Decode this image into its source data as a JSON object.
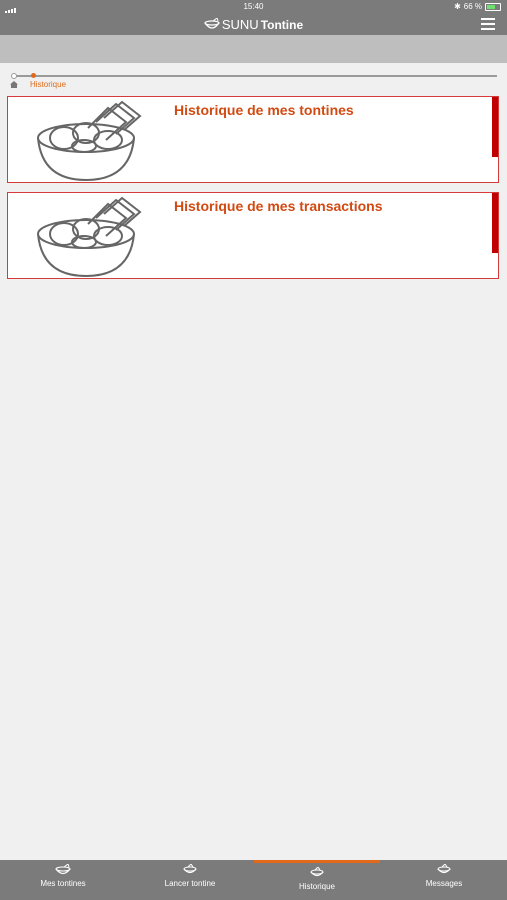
{
  "status_bar": {
    "time": "15:40",
    "battery": "66 %",
    "battery_level": 0.66
  },
  "header": {
    "brand_prefix": "SUNU",
    "brand_name": "Tontine"
  },
  "breadcrumb": {
    "current": "Historique"
  },
  "cards": [
    {
      "title": "Historique de mes tontines"
    },
    {
      "title": "Historique de mes transactions"
    }
  ],
  "tabs": [
    {
      "label": "Mes tontines"
    },
    {
      "label": "Lancer tontine"
    },
    {
      "label": "Historique"
    },
    {
      "label": "Messages"
    }
  ],
  "colors": {
    "accent": "#e06a1a",
    "card_border": "#d43a3a",
    "card_bar": "#c00000",
    "bar_bg": "#7b7b7b",
    "title": "#d24a12"
  }
}
